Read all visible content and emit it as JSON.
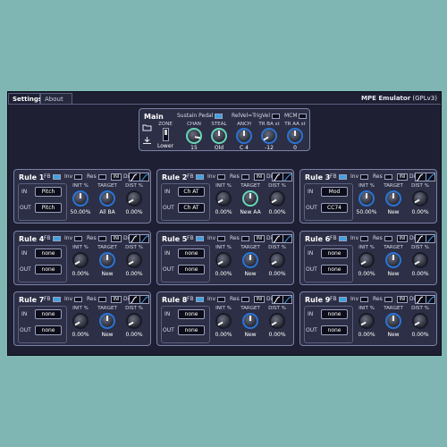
{
  "tabs": [
    "Settings",
    "About"
  ],
  "app_title": "MPE Emulator",
  "app_license": "(GPLv3)",
  "main": {
    "title": "Main",
    "sustain_label": "Sustain Pedal",
    "relvel_label": "RelVel=TrigVel",
    "mcm_label": "MCM",
    "zone_label": "ZONE",
    "zone_value": "Lower",
    "knobs": [
      {
        "label": "CHAN",
        "value": "15"
      },
      {
        "label": "STEAL",
        "value": "Old"
      },
      {
        "label": "ANCH",
        "value": "C 4"
      },
      {
        "label": "TR BA st",
        "value": "-12"
      },
      {
        "label": "TR AA st",
        "value": "0"
      }
    ]
  },
  "rule_labels": {
    "fb": "FB",
    "inv": "Inv",
    "res": "Res",
    "ini": "INI",
    "dist": "Dist",
    "in": "IN",
    "out": "OUT",
    "init": "INIT %",
    "target": "TARGET",
    "distp": "DIST %"
  },
  "rules": [
    {
      "title": "Rule 1",
      "in": "Pitch",
      "out": "Pitch",
      "init": "50.00%",
      "target": "All BA",
      "dist": "0.00%"
    },
    {
      "title": "Rule 2",
      "in": "Ch AT",
      "out": "Ch AT",
      "init": "0.00%",
      "target": "New AA",
      "dist": "0.00%"
    },
    {
      "title": "Rule 3",
      "in": "Mod",
      "out": "CC74",
      "init": "50.00%",
      "target": "New",
      "dist": "0.00%"
    },
    {
      "title": "Rule 4",
      "in": "none",
      "out": "none",
      "init": "0.00%",
      "target": "New",
      "dist": "0.00%"
    },
    {
      "title": "Rule 5",
      "in": "none",
      "out": "none",
      "init": "0.00%",
      "target": "New",
      "dist": "0.00%"
    },
    {
      "title": "Rule 6",
      "in": "none",
      "out": "none",
      "init": "0.00%",
      "target": "New",
      "dist": "0.00%"
    },
    {
      "title": "Rule 7",
      "in": "none",
      "out": "none",
      "init": "0.00%",
      "target": "New",
      "dist": "0.00%"
    },
    {
      "title": "Rule 8",
      "in": "none",
      "out": "none",
      "init": "0.00%",
      "target": "New",
      "dist": "0.00%"
    },
    {
      "title": "Rule 9",
      "in": "none",
      "out": "none",
      "init": "0.00%",
      "target": "New",
      "dist": "0.00%"
    }
  ]
}
